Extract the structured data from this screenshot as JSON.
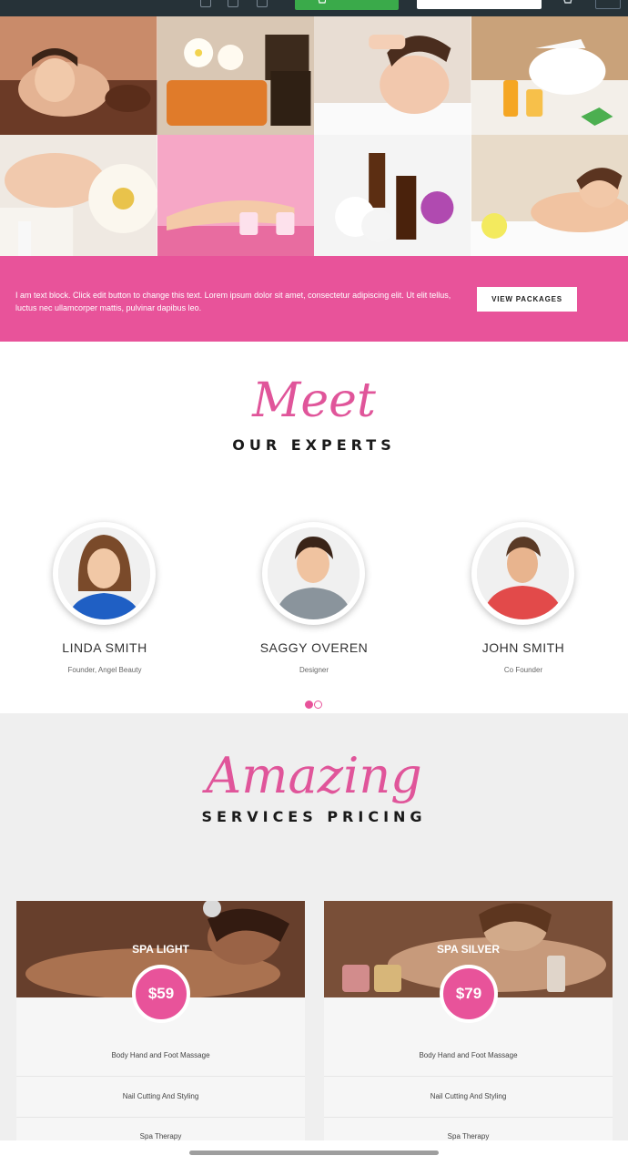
{
  "banner": {
    "text": "I am text block. Click edit button to change this text. Lorem ipsum dolor sit amet, consectetur adipiscing elit. Ut elit tellus, luctus nec ullamcorper mattis, pulvinar dapibus leo.",
    "button_label": "VIEW PACKAGES"
  },
  "experts_section": {
    "script_heading": "Meet",
    "title": "OUR EXPERTS",
    "members": [
      {
        "name": "LINDA SMITH",
        "role": "Founder, Angel Beauty"
      },
      {
        "name": "SAGGY OVEREN",
        "role": "Designer"
      },
      {
        "name": "JOHN SMITH",
        "role": "Co Founder"
      }
    ],
    "carousel_active_dot": 1,
    "carousel_dot_count": 2
  },
  "pricing_section": {
    "script_heading": "Amazing",
    "title": "SERVICES PRICING",
    "plans": [
      {
        "name": "SPA LIGHT",
        "price": "$59",
        "features": [
          "Body Hand and Foot Massage",
          "Nail Cutting And Styling",
          "Spa Therapy"
        ]
      },
      {
        "name": "SPA SILVER",
        "price": "$79",
        "features": [
          "Body Hand and Foot Massage",
          "Nail Cutting And Styling",
          "Spa Therapy"
        ]
      }
    ]
  },
  "colors": {
    "accent": "#e8539a",
    "topbar": "#263238",
    "green_button": "#3aaa4a"
  },
  "icons": [
    "cart-icon",
    "menu-icon"
  ]
}
